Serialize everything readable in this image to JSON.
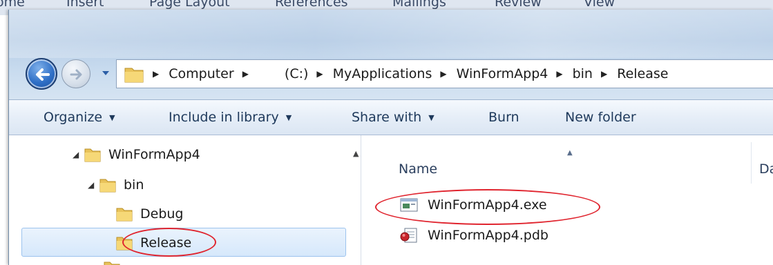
{
  "ribbon_tabs": [
    "ome",
    "Insert",
    "Page Layout",
    "References",
    "Mailings",
    "Review",
    "View"
  ],
  "address_bar": {
    "crumbs": [
      "Computer",
      "(C:)",
      "MyApplications",
      "WinFormApp4",
      "bin",
      "Release"
    ]
  },
  "toolbar": {
    "organize": "Organize",
    "include_in_library": "Include in library",
    "share_with": "Share with",
    "burn": "Burn",
    "new_folder": "New folder"
  },
  "tree": {
    "items": [
      {
        "label": "WinFormApp4",
        "expanded": true
      },
      {
        "label": "bin",
        "expanded": true
      },
      {
        "label": "Debug"
      },
      {
        "label": "Release",
        "selected": true
      }
    ]
  },
  "file_list": {
    "columns": {
      "name": "Name",
      "date": "Da"
    },
    "files": [
      {
        "name": "WinFormApp4.exe",
        "icon": "exe-icon"
      },
      {
        "name": "WinFormApp4.pdb",
        "icon": "pdb-icon"
      }
    ]
  },
  "colors": {
    "highlight": "#e0242e",
    "selection": "#d6e8fb"
  }
}
